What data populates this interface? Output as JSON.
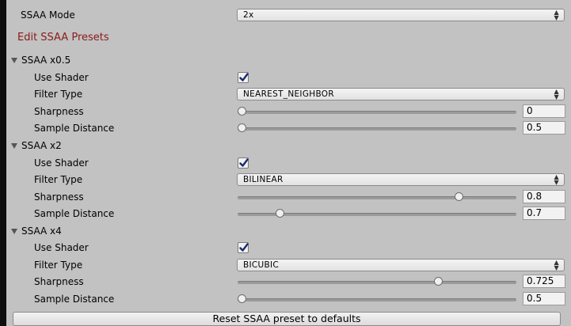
{
  "ssaa_mode": {
    "label": "SSAA Mode",
    "value": "2x"
  },
  "edit_presets_label": "Edit SSAA Presets",
  "labels": {
    "use_shader": "Use Shader",
    "filter_type": "Filter Type",
    "sharpness": "Sharpness",
    "sample_distance": "Sample Distance"
  },
  "presets": [
    {
      "title": "SSAA x0.5",
      "use_shader": true,
      "filter_type": "NEAREST_NEIGHBOR",
      "sharpness": "0",
      "sample_distance": "0.5",
      "sharpness_fraction": 0.0,
      "sample_distance_fraction": 0.0
    },
    {
      "title": "SSAA x2",
      "use_shader": true,
      "filter_type": "BILINEAR",
      "sharpness": "0.8",
      "sample_distance": "0.7",
      "sharpness_fraction": 0.8,
      "sample_distance_fraction": 0.14
    },
    {
      "title": "SSAA x4",
      "use_shader": true,
      "filter_type": "BICUBIC",
      "sharpness": "0.725",
      "sample_distance": "0.5",
      "sharpness_fraction": 0.725,
      "sample_distance_fraction": 0.0
    }
  ],
  "reset_button_label": "Reset SSAA preset to defaults",
  "icons": {
    "foldout": "triangle-down-icon",
    "dropdown": "updown-chevron-icon",
    "check": "checkmark-icon"
  }
}
